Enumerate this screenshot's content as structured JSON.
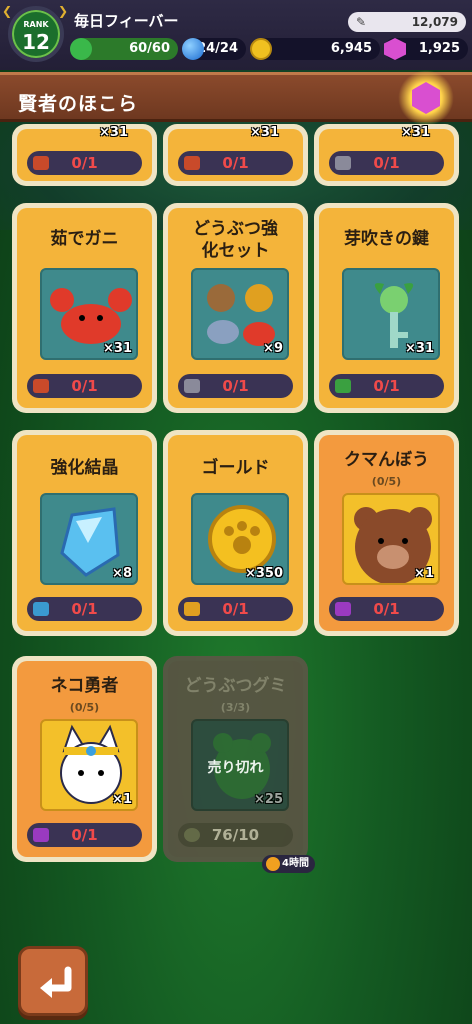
{
  "header": {
    "rank_label": "RANK",
    "rank_value": "12",
    "title": "毎日フィーバー",
    "stamina": "60/60",
    "orbs": "24/24",
    "coins": "6,945",
    "gems": "1,925",
    "top_value": "12,079"
  },
  "banner": {
    "title": "賢者のほこら"
  },
  "top_row": [
    {
      "count": "×31",
      "progress": "0/1"
    },
    {
      "count": "×31",
      "progress": "0/1"
    },
    {
      "count": "×31",
      "progress": "0/1"
    }
  ],
  "cards": [
    {
      "name": "茹でガニ",
      "count": "×31",
      "progress": "0/1"
    },
    {
      "name": "どうぶつ強化セット",
      "name_line1": "どうぶつ強",
      "name_line2": "化セット",
      "count": "×9",
      "progress": "0/1"
    },
    {
      "name": "芽吹きの鍵",
      "count": "×31",
      "progress": "0/1"
    },
    {
      "name": "強化結晶",
      "count": "×8",
      "progress": "0/1"
    },
    {
      "name": "ゴールド",
      "count": "×350",
      "progress": "0/1"
    },
    {
      "name": "クマんぼう",
      "sub": "(0/5)",
      "count": "×1",
      "progress": "0/1"
    },
    {
      "name": "ネコ勇者",
      "sub": "(0/5)",
      "count": "×1",
      "progress": "0/1"
    },
    {
      "name": "どうぶつグミ",
      "sub": "(3/3)",
      "count": "×25",
      "progress": "76/10",
      "soldout": "売り切れ"
    }
  ],
  "timer": "4時間",
  "colors": {
    "accent": "#f4b43a",
    "orange": "#f39a3e",
    "progress_text": "#f04a4a",
    "bar_bg": "#3a3354"
  }
}
